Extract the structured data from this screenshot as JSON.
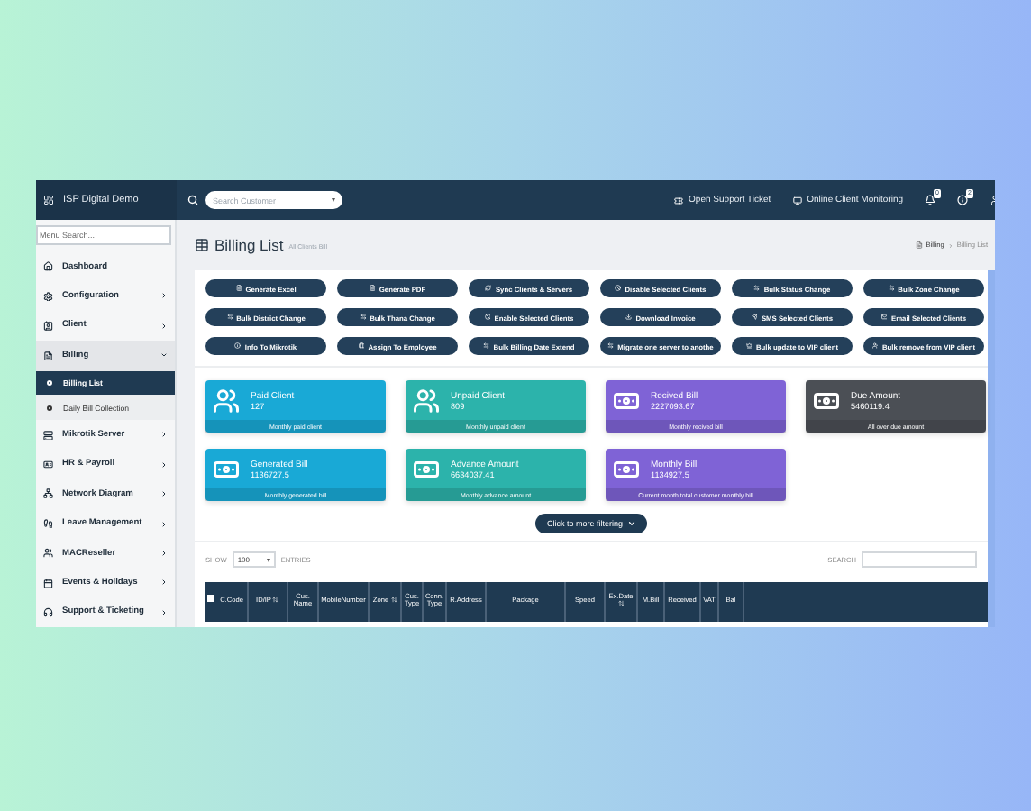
{
  "topbar": {
    "brand": "ISP Digital Demo",
    "search_placeholder": "Search Customer",
    "links": [
      {
        "label": "Open Support Ticket"
      },
      {
        "label": "Online Client Monitoring"
      }
    ],
    "alerts": [
      {
        "badge": "0"
      },
      {
        "badge": "2"
      }
    ]
  },
  "sidebar": {
    "search_placeholder": "Menu Search...",
    "items": [
      {
        "label": "Dashboard",
        "has_submenu": false,
        "expanded": false,
        "selected": false
      },
      {
        "label": "Configuration",
        "has_submenu": true,
        "expanded": false,
        "selected": false
      },
      {
        "label": "Client",
        "has_submenu": true,
        "expanded": false,
        "selected": false
      },
      {
        "label": "Billing",
        "has_submenu": true,
        "expanded": true,
        "selected": true,
        "children": [
          {
            "label": "Billing List",
            "selected": true
          },
          {
            "label": "Daily Bill Collection",
            "selected": false
          }
        ]
      },
      {
        "label": "Mikrotik Server",
        "has_submenu": true,
        "expanded": false,
        "selected": false
      },
      {
        "label": "HR & Payroll",
        "has_submenu": true,
        "expanded": false,
        "selected": false
      },
      {
        "label": "Network Diagram",
        "has_submenu": true,
        "expanded": false,
        "selected": false
      },
      {
        "label": "Leave Management",
        "has_submenu": true,
        "expanded": false,
        "selected": false
      },
      {
        "label": "MACReseller",
        "has_submenu": true,
        "expanded": false,
        "selected": false
      },
      {
        "label": "Events & Holidays",
        "has_submenu": true,
        "expanded": false,
        "selected": false
      },
      {
        "label": "Support & Ticketing",
        "has_submenu": true,
        "expanded": false,
        "selected": false
      }
    ]
  },
  "page": {
    "title": "Billing List",
    "subtitle": "All Clients Bill",
    "breadcrumb": [
      "Billing",
      "Billing List"
    ]
  },
  "actions": [
    {
      "label": "Generate Excel"
    },
    {
      "label": "Generate PDF"
    },
    {
      "label": "Sync Clients & Servers"
    },
    {
      "label": "Disable Selected Clients"
    },
    {
      "label": "Bulk Status Change"
    },
    {
      "label": "Bulk Zone Change"
    },
    {
      "label": "Bulk District Change"
    },
    {
      "label": "Bulk Thana Change"
    },
    {
      "label": "Enable Selected Clients"
    },
    {
      "label": "Download Invoice"
    },
    {
      "label": "SMS Selected Clients"
    },
    {
      "label": "Email Selected Clients"
    },
    {
      "label": "Info To Mikrotik"
    },
    {
      "label": "Assign To Employee"
    },
    {
      "label": "Bulk Billing Date Extend"
    },
    {
      "label": "Migrate one server to anothe"
    },
    {
      "label": "Bulk update to VIP client"
    },
    {
      "label": "Bulk remove from VIP client"
    }
  ],
  "stats": [
    {
      "title": "Paid Client",
      "value": "127",
      "footer": "Monthly paid client",
      "color": "#19a9d6"
    },
    {
      "title": "Unpaid Client",
      "value": "809",
      "footer": "Monthly unpaid client",
      "color": "#2cb3ab"
    },
    {
      "title": "Recived Bill",
      "value": "2227093.67",
      "footer": "Monthly recived bill",
      "color": "#7f63d6"
    },
    {
      "title": "Due Amount",
      "value": "5460119.4",
      "footer": "All over due amount",
      "color": "#4b4f55"
    },
    {
      "title": "Generated Bill",
      "value": "1136727.5",
      "footer": "Monthly generated bill",
      "color": "#19a9d6"
    },
    {
      "title": "Advance Amount",
      "value": "6634037.41",
      "footer": "Monthly advance amount",
      "color": "#2cb3ab"
    },
    {
      "title": "Monthly Bill",
      "value": "1134927.5",
      "footer": "Current month total customer monthly bill",
      "color": "#7f63d6"
    }
  ],
  "filter_button": "Click to more filtering",
  "table_controls": {
    "show": "SHOW",
    "page_size": "100",
    "entries": "ENTRIES",
    "search": "SEARCH"
  },
  "table": {
    "select_all": {
      "checked": false
    },
    "columns": [
      {
        "label": "C.Code",
        "sortable": false
      },
      {
        "label": "ID/IP",
        "sortable": true
      },
      {
        "label": "Cus. Name",
        "sortable": false
      },
      {
        "label": "MobileNumber",
        "sortable": false
      },
      {
        "label": "Zone",
        "sortable": true
      },
      {
        "label": "Cus. Type",
        "sortable": false
      },
      {
        "label": "Conn. Type",
        "sortable": false
      },
      {
        "label": "R.Address",
        "sortable": false
      },
      {
        "label": "Package",
        "sortable": false
      },
      {
        "label": "Speed",
        "sortable": false
      },
      {
        "label": "Ex.Date",
        "sortable": true
      },
      {
        "label": "M.Bill",
        "sortable": false
      },
      {
        "label": "Received",
        "sortable": false
      },
      {
        "label": "VAT",
        "sortable": false
      },
      {
        "label": "Bal",
        "sortable": false
      }
    ]
  }
}
